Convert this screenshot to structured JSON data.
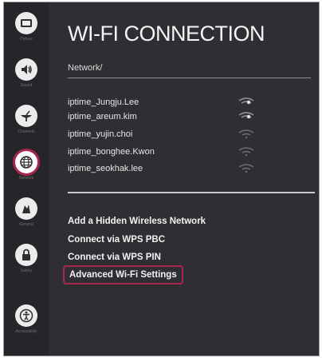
{
  "sidebar": {
    "items": [
      {
        "label": "Picture",
        "icon": "picture-icon"
      },
      {
        "label": "Sound",
        "icon": "sound-icon"
      },
      {
        "label": "Channels",
        "icon": "channels-icon"
      },
      {
        "label": "Network",
        "icon": "network-icon"
      },
      {
        "label": "General",
        "icon": "general-icon"
      },
      {
        "label": "Safety",
        "icon": "lock-icon"
      },
      {
        "label": "Accessibility",
        "icon": "accessibility-icon"
      }
    ],
    "active_index": 3
  },
  "header": {
    "title": "WI-FI CONNECTION",
    "breadcrumb": "Network/"
  },
  "networks": [
    {
      "name": "iptime_Jungju.Lee",
      "icon": "wifi-signal-icon"
    },
    {
      "name": "iptime_areum.kim",
      "icon": "wifi-signal-icon"
    },
    {
      "name": "iptime_yujin.choi",
      "icon": "wifi-signal-icon"
    },
    {
      "name": "iptime_bonghee.Kwon",
      "icon": "wifi-signal-icon"
    },
    {
      "name": "iptime_seokhak.lee",
      "icon": "wifi-signal-icon"
    }
  ],
  "options": {
    "add_hidden": "Add a Hidden Wireless Network",
    "wps_pbc": "Connect via WPS PBC",
    "wps_pin": "Connect via WPS PIN",
    "advanced": "Advanced Wi-Fi Settings"
  },
  "colors": {
    "background": "#2f2f33",
    "sidebar": "#26262a",
    "focus": "#a8264d"
  }
}
